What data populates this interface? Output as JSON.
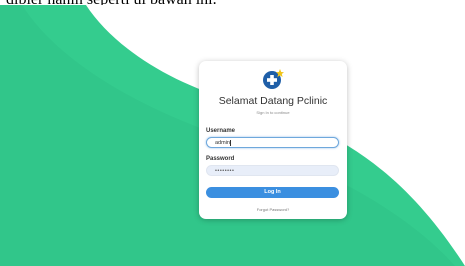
{
  "document": {
    "intro_line": "dibier hanin seperti ui bawah ini."
  },
  "login": {
    "logo_icon": "medical-cross-icon",
    "title": "Selamat Datang Pclinic",
    "subtitle": "Sign In to continue",
    "username_label": "Username",
    "username_value": "admin",
    "password_label": "Password",
    "password_mask": "••••••••",
    "login_button": "Log In",
    "forgot_link": "Forgot Password?"
  },
  "colors": {
    "background_green": "#34cc8e",
    "accent_blue": "#3b8fe0",
    "logo_star": "#f0c419"
  }
}
